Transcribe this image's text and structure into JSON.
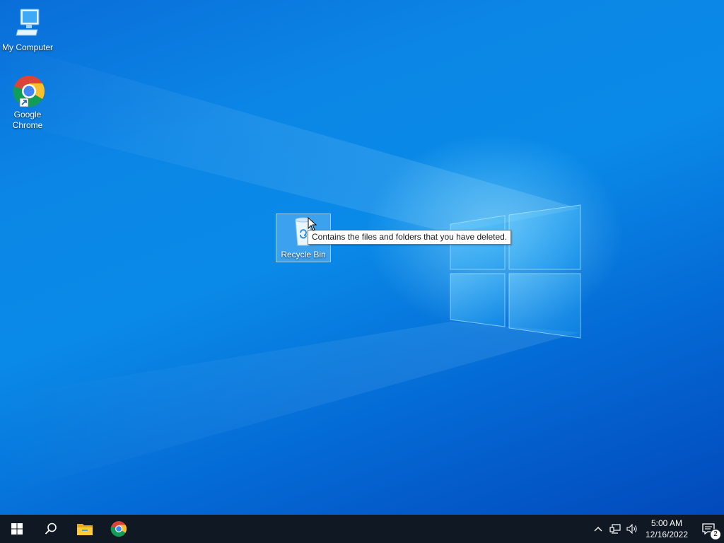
{
  "desktop": {
    "icons": [
      {
        "label": "My Computer",
        "icon": "my-computer-icon"
      },
      {
        "label": "Google Chrome",
        "icon": "chrome-shortcut-icon"
      },
      {
        "label": "Recycle Bin",
        "icon": "recycle-bin-icon",
        "selected": true
      }
    ],
    "tooltip": "Contains the files and folders that you have deleted."
  },
  "taskbar": {
    "pinned": [
      {
        "name": "start-button",
        "icon": "windows-logo-icon"
      },
      {
        "name": "search-button",
        "icon": "search-icon"
      },
      {
        "name": "file-explorer",
        "icon": "folder-icon"
      },
      {
        "name": "google-chrome",
        "icon": "chrome-icon"
      }
    ],
    "tray": {
      "clock_time": "5:00 AM",
      "clock_date": "12/16/2022",
      "notification_count": "2"
    }
  },
  "colors": {
    "taskbar": "#101823",
    "desktop_accent": "#0a86e6"
  }
}
